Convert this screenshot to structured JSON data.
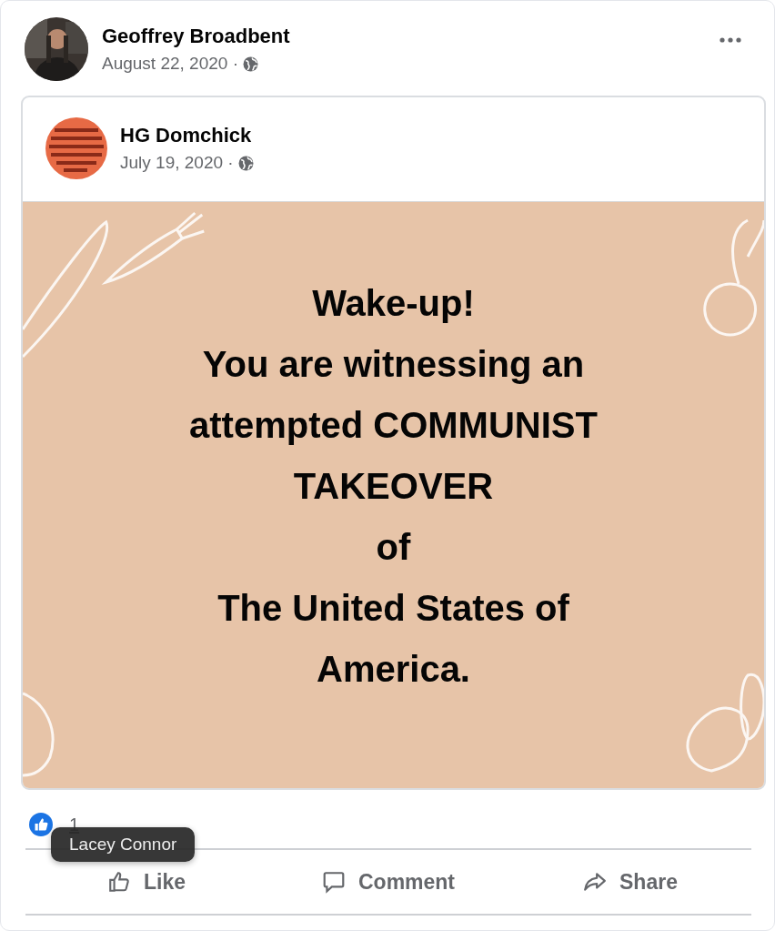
{
  "post": {
    "author": "Geoffrey Broadbent",
    "date": "August 22, 2020 ·",
    "shared": {
      "author": "HG Domchick",
      "date": "July 19, 2020 ·",
      "text_lines": [
        "Wake-up!",
        "You are witnessing an",
        "attempted COMMUNIST",
        "TAKEOVER",
        "of",
        "The United States of",
        "America."
      ]
    }
  },
  "reactions": {
    "count": "1"
  },
  "actions": [
    {
      "kind": "like",
      "label": "Like"
    },
    {
      "kind": "comment",
      "label": "Comment"
    },
    {
      "kind": "share",
      "label": "Share"
    }
  ],
  "tooltip": {
    "text": "Lacey Connor"
  }
}
